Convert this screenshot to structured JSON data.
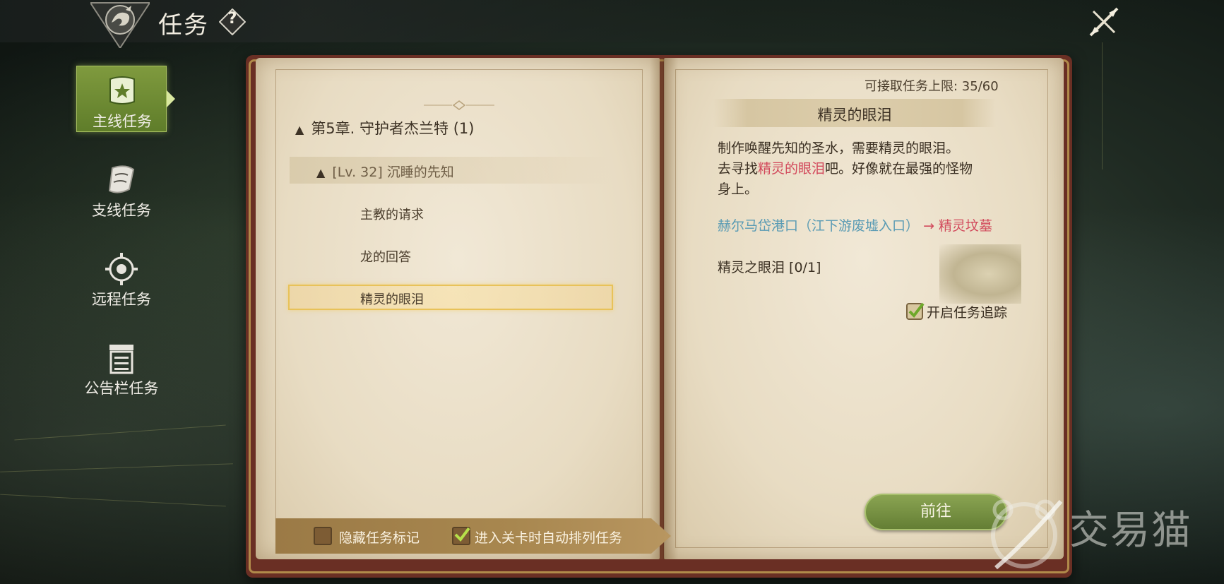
{
  "header": {
    "title": "任务",
    "help_symbol": "?"
  },
  "sidebar": {
    "items": [
      {
        "label": "主线任务",
        "active": true,
        "icon": "main-quest-scroll-icon"
      },
      {
        "label": "支线任务",
        "active": false,
        "icon": "side-quest-scroll-icon"
      },
      {
        "label": "远程任务",
        "active": false,
        "icon": "target-icon"
      },
      {
        "label": "公告栏任务",
        "active": false,
        "icon": "notice-board-icon"
      }
    ]
  },
  "quest_tree": {
    "chapter": "第5章. 守护者杰兰特 (1)",
    "subchapter": "[Lv. 32] 沉睡的先知",
    "quests": [
      "主教的请求",
      "龙的回答",
      "精灵的眼泪"
    ],
    "selected_index": 2
  },
  "bottom_options": {
    "hide_marker_label": "隐藏任务标记",
    "hide_marker_checked": false,
    "auto_sort_label": "进入关卡时自动排列任务",
    "auto_sort_checked": true
  },
  "detail": {
    "limit": "可接取任务上限: 35/60",
    "title": "精灵的眼泪",
    "desc_line1": "制作唤醒先知的圣水，需要精灵的眼泪。",
    "desc_part2_pre": "去寻找",
    "desc_part2_highlight": "精灵的眼泪",
    "desc_part2_post": "吧。好像就在最强的怪物身上。",
    "location_from": "赫尔马岱港口（江下游废墟入口）",
    "location_arrow": "→",
    "location_to": "精灵坟墓",
    "objective": "精灵之眼泪 [0/1]",
    "track_label": "开启任务追踪",
    "track_checked": true,
    "go_button": "前往"
  },
  "watermark": {
    "text": "交易猫"
  },
  "colors": {
    "accent_green": "#7f9a3e",
    "highlight_red": "#d2475a",
    "location_blue": "#5a9bb4",
    "book_leather": "#6a2f24",
    "selection_gold": "#e8c259"
  }
}
